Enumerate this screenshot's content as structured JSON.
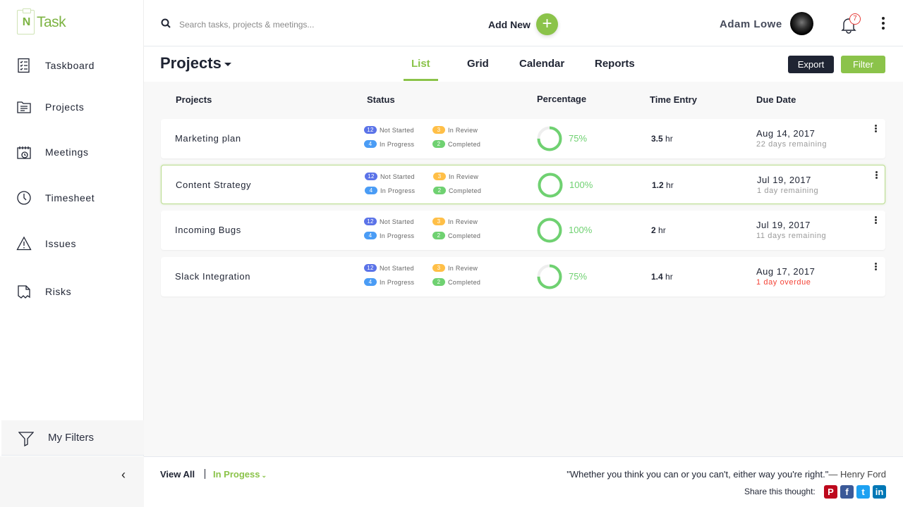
{
  "app": {
    "logo_text": "Task",
    "logo_mark": "N"
  },
  "sidebar": {
    "items": [
      {
        "label": "Taskboard",
        "icon": "checklist-icon"
      },
      {
        "label": "Projects",
        "icon": "folder-icon"
      },
      {
        "label": "Meetings",
        "icon": "calendar-clock-icon"
      },
      {
        "label": "Timesheet",
        "icon": "clock-icon"
      },
      {
        "label": "Issues",
        "icon": "warning-icon"
      },
      {
        "label": "Risks",
        "icon": "risk-flag-icon"
      }
    ],
    "my_filters": "My Filters",
    "collapse_glyph": "‹"
  },
  "topbar": {
    "search_placeholder": "Search tasks, projects & meetings...",
    "add_new_label": "Add New",
    "add_glyph": "+",
    "user_name": "Adam Lowe",
    "notification_count": "7"
  },
  "subbar": {
    "title": "Projects",
    "tabs": [
      {
        "label": "List",
        "active": true
      },
      {
        "label": "Grid",
        "active": false
      },
      {
        "label": "Calendar",
        "active": false
      },
      {
        "label": "Reports",
        "active": false
      }
    ],
    "export_label": "Export",
    "filter_label": "Filter"
  },
  "table": {
    "columns": [
      "Projects",
      "Status",
      "Percentage",
      "Time Entry",
      "Due Date"
    ],
    "status_labels": {
      "not_started": "Not Started",
      "in_review": "In Review",
      "in_progress": "In Progress",
      "completed": "Completed"
    },
    "status_colors": {
      "not_started": "#5b73e8",
      "in_review": "#ffbf47",
      "in_progress": "#4a9cf5",
      "completed": "#6fd171"
    },
    "hr_unit": "hr",
    "rows": [
      {
        "name": "Marketing plan",
        "not_started": "12",
        "in_review": "3",
        "in_progress": "4",
        "completed": "2",
        "percent": 75,
        "percent_label": "75%",
        "time": "3.5",
        "due_date": "Aug 14, 2017",
        "remaining": "22 days remaining",
        "overdue": false,
        "highlighted": false
      },
      {
        "name": "Content Strategy",
        "not_started": "12",
        "in_review": "3",
        "in_progress": "4",
        "completed": "2",
        "percent": 100,
        "percent_label": "100%",
        "time": "1.2",
        "due_date": "Jul 19, 2017",
        "remaining": "1 day remaining",
        "overdue": false,
        "highlighted": true
      },
      {
        "name": "Incoming Bugs",
        "not_started": "12",
        "in_review": "3",
        "in_progress": "4",
        "completed": "2",
        "percent": 100,
        "percent_label": "100%",
        "time": "2",
        "due_date": "Jul 19, 2017",
        "remaining": "11 days remaining",
        "overdue": false,
        "highlighted": false
      },
      {
        "name": "Slack Integration",
        "not_started": "12",
        "in_review": "3",
        "in_progress": "4",
        "completed": "2",
        "percent": 75,
        "percent_label": "75%",
        "time": "1.4",
        "due_date": "Aug 17, 2017",
        "remaining": "1 day overdue",
        "overdue": true,
        "highlighted": false
      }
    ]
  },
  "footer": {
    "view_all": "View All",
    "in_progress": "In Progess",
    "quote": "\"Whether you think you can or you can't, either way you're right.\"",
    "author": "— Henry Ford",
    "share_label": "Share this thought:",
    "social": [
      {
        "name": "pinterest",
        "glyph": "P",
        "color": "#bd081c"
      },
      {
        "name": "facebook",
        "glyph": "f",
        "color": "#3b5998"
      },
      {
        "name": "twitter",
        "glyph": "t",
        "color": "#1da1f2"
      },
      {
        "name": "linkedin",
        "glyph": "in",
        "color": "#0077b5"
      }
    ]
  },
  "colors": {
    "accent": "#8bc34a",
    "dark": "#1f2433",
    "ring": "#6fd171",
    "overdue": "#f44336"
  }
}
